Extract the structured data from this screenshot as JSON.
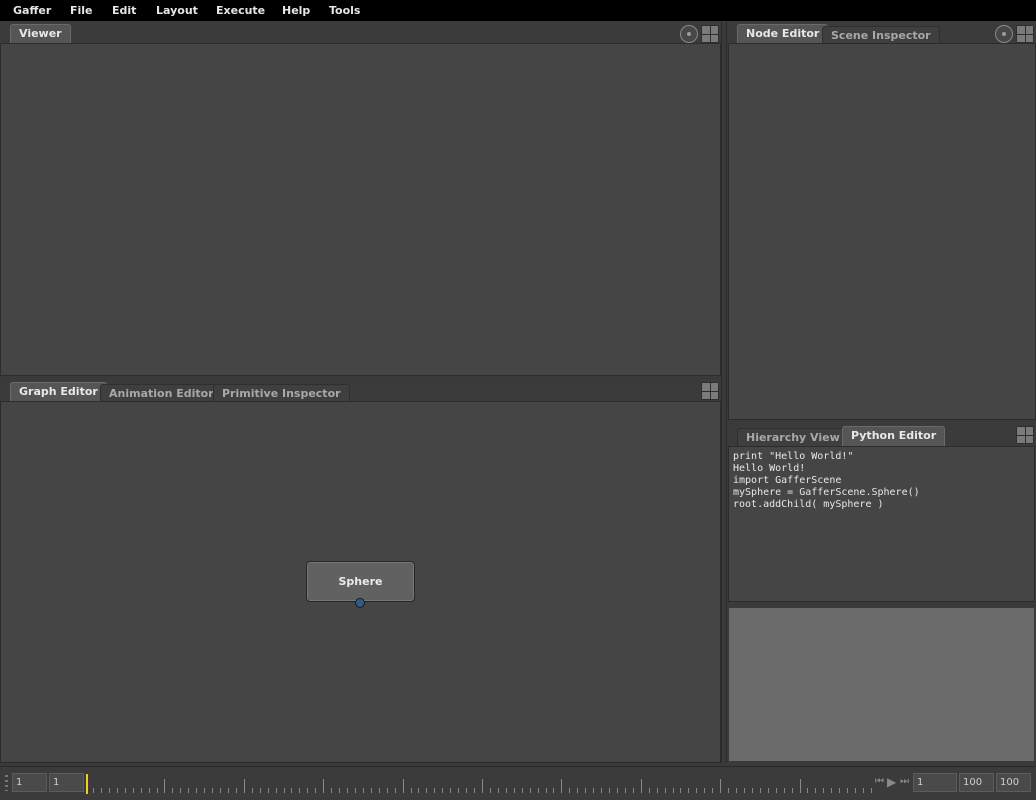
{
  "menubar": {
    "items": [
      "Gaffer",
      "File",
      "Edit",
      "Layout",
      "Execute",
      "Help",
      "Tools"
    ]
  },
  "viewer_panel": {
    "tabs": [
      "Viewer"
    ]
  },
  "node_editor_panel": {
    "tabs": [
      "Node Editor",
      "Scene Inspector"
    ]
  },
  "graph_editor_panel": {
    "tabs": [
      "Graph Editor",
      "Animation Editor",
      "Primitive Inspector"
    ],
    "node": {
      "label": "Sphere"
    }
  },
  "python_panel": {
    "tabs": [
      "Hierarchy View",
      "Python Editor"
    ],
    "output_lines": [
      "print \"Hello World!\"",
      "Hello World!",
      "import GafferScene",
      "mySphere = GafferScene.Sphere()",
      "root.addChild( mySphere )"
    ],
    "input_value": ""
  },
  "timeline": {
    "start_frame": "1",
    "range_start": "1",
    "current_frame": "1",
    "range_end": "100",
    "end_frame": "100",
    "playhead_color": "#f0d020"
  },
  "colors": {
    "panel_bg": "#454545",
    "menubar_bg": "#000000",
    "node_bg": "#616161",
    "plug": "#2f5a86"
  }
}
